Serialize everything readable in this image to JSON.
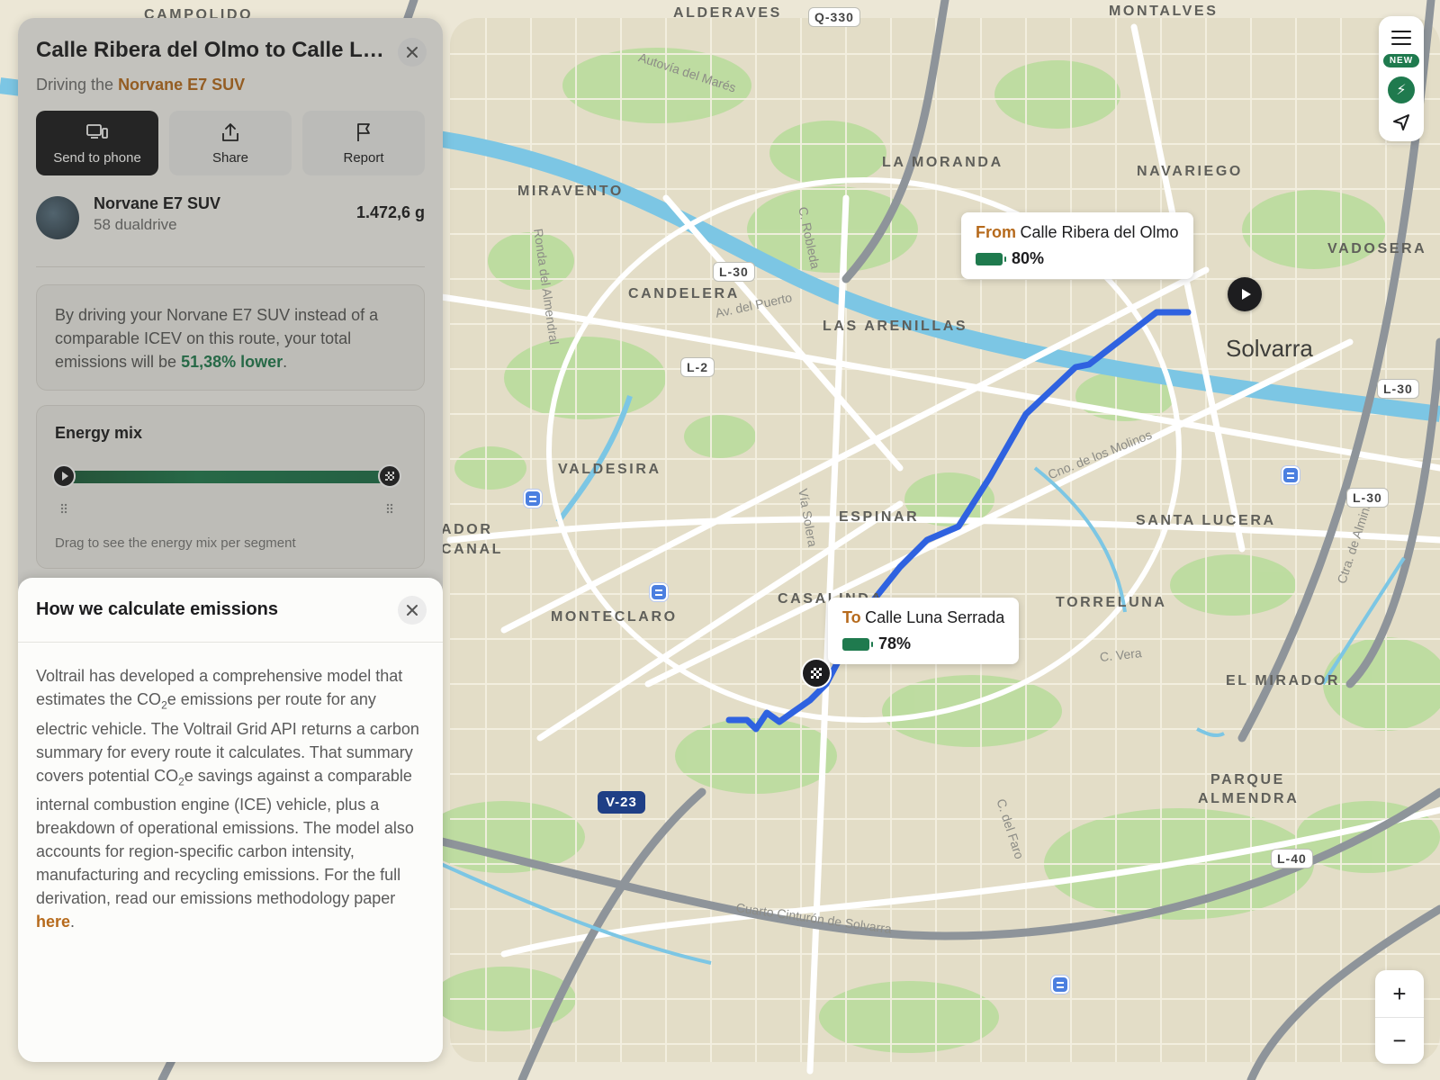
{
  "route_panel": {
    "title": "Calle Ribera del Olmo to Calle Lun...",
    "driving_prefix": "Driving the",
    "vehicle_name": "Norvane E7 SUV",
    "actions": {
      "send_to_phone": "Send to phone",
      "share": "Share",
      "report": "Report"
    },
    "vehicle_row": {
      "name": "Norvane E7 SUV",
      "sub": "58 dualdrive",
      "value": "1.472,6 g"
    },
    "info_text_before": "By driving your Norvane E7 SUV instead of a comparable ICEV on this route, your total emissions will be",
    "info_highlight": "51,38% lower",
    "info_text_after": ".",
    "energy_mix": {
      "title": "Energy mix",
      "hint": "Drag to see the energy mix per segment"
    }
  },
  "emissions_sheet": {
    "title": "How we calculate emissions",
    "body_p1": "Voltrail has developed a comprehensive model that estimates the CO",
    "sub2": "2",
    "body_p2": "e emissions per route for any electric vehicle. The Voltrail Grid API returns a carbon summary for every route it calculates. That summary covers potential CO",
    "body_p3": "e savings against a comparable internal combustion engine (ICE) vehicle, plus a breakdown of operational emissions. The model also accounts for region-specific carbon intensity, manufacturing and recycling emissions. For the full derivation, read our emissions methodology paper",
    "link": "here",
    "end": "."
  },
  "map": {
    "callout_from": {
      "lead": "From",
      "place": "Calle Ribera del Olmo",
      "battery": "80%"
    },
    "callout_to": {
      "lead": "To",
      "place": "Calle Luna Serrada",
      "battery": "78%"
    },
    "city": "Solvarra",
    "districts": [
      "CAMPOLIDO",
      "ALDERAVES",
      "MONTALVES",
      "LA MORANDA",
      "NAVARIEGO",
      "MIRAVENTO",
      "VADOSERA",
      "CANDELERA",
      "LAS ARENILLAS",
      "VALDESIRA",
      "ESPINAR",
      "SANTA LUCERA",
      "ADOR",
      "CANAL",
      "MONTECLARO",
      "CASALINDA",
      "TORRELUNA",
      "EL MIRADOR",
      "PARQUE",
      "ALMENDRA"
    ],
    "streets": [
      "Autovía del Marés",
      "C. Robleda",
      "Ronda del Almendral",
      "Av. del Puerto",
      "Cno. de los Molinos",
      "Vía Solera",
      "C. Vera",
      "Ctra. de Almina",
      "C. del Faro",
      "Cuarto Cinturón de Solvarra"
    ],
    "shields": [
      "Q-330",
      "L-30",
      "L-2",
      "L-30",
      "L-30",
      "L-40",
      "V-23"
    ],
    "new_badge": "NEW",
    "zoom_in": "+",
    "zoom_out": "−",
    "route_color": "#2f62e0",
    "accent_color": "#b66a1c",
    "green_color": "#1f7a4e"
  }
}
